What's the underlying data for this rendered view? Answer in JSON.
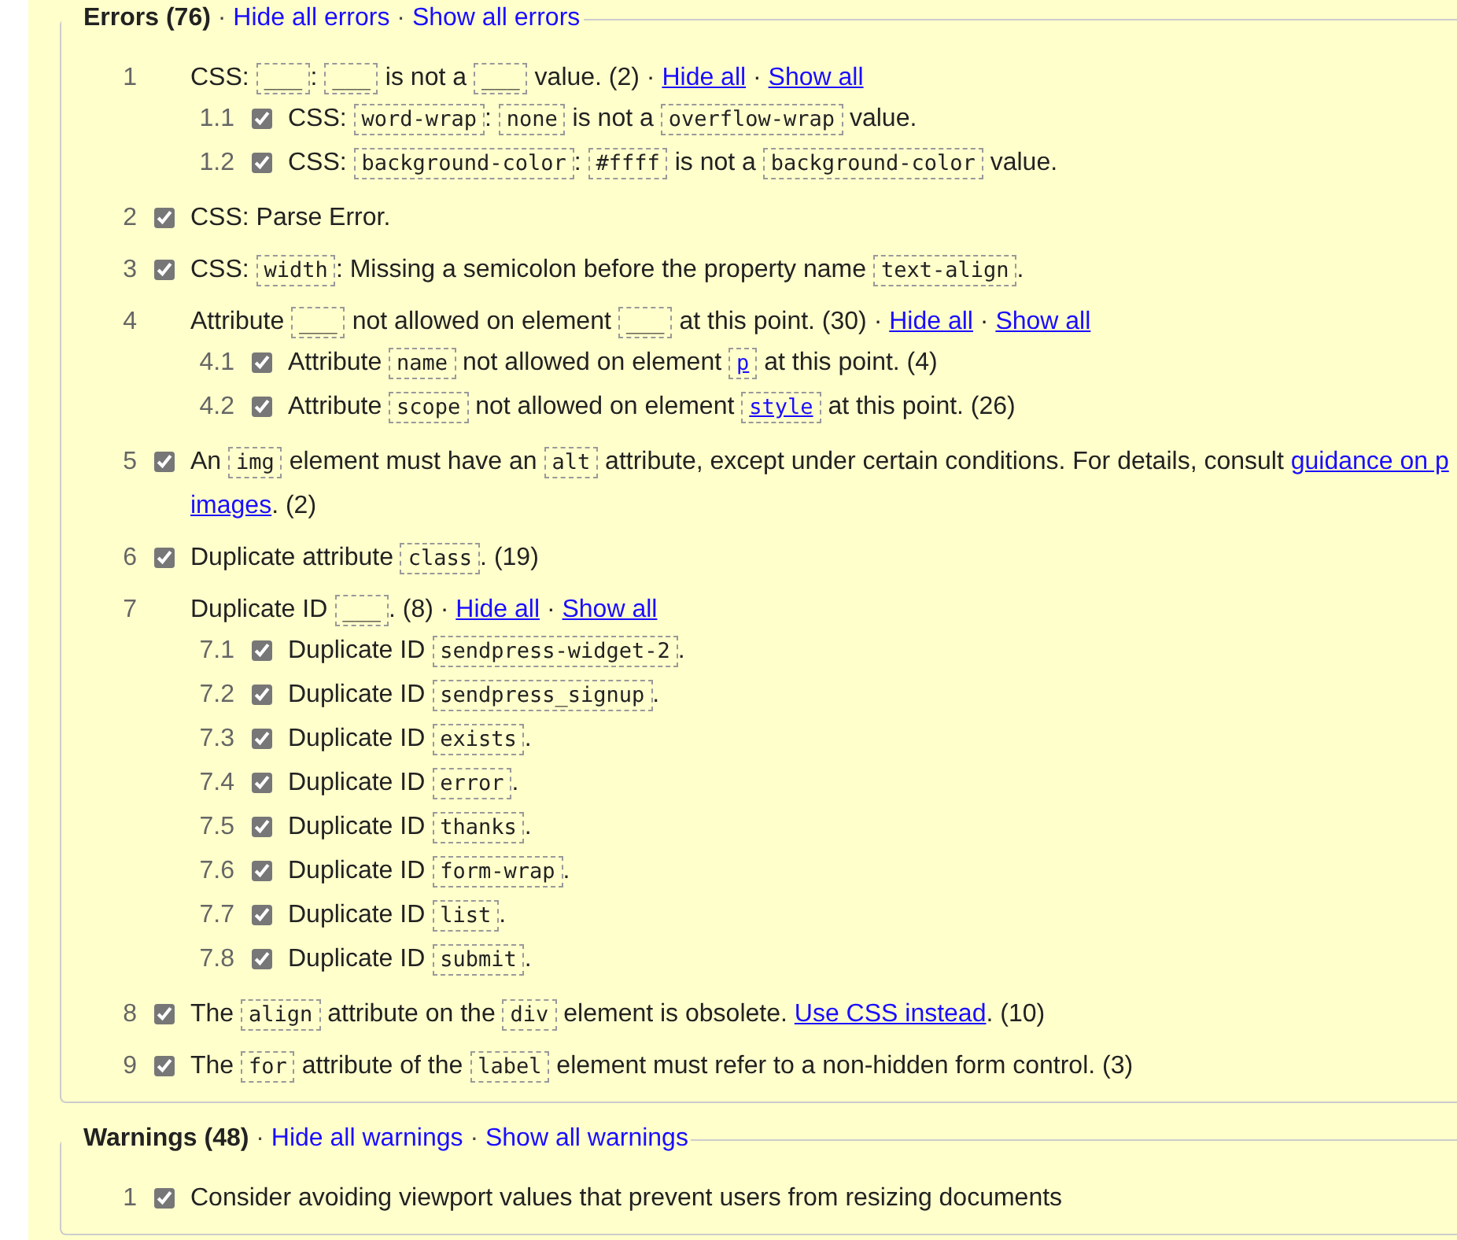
{
  "errors": {
    "title": "Errors (76)",
    "separator": " · ",
    "links": [
      "Hide all errors",
      "Show all errors"
    ],
    "items": [
      {
        "number": "1",
        "parts": [
          {
            "kind": "text",
            "text": "CSS: "
          },
          {
            "kind": "code",
            "text": "___"
          },
          {
            "kind": "text",
            "text": ": "
          },
          {
            "kind": "code",
            "text": "___"
          },
          {
            "kind": "text",
            "text": " is not a "
          },
          {
            "kind": "code",
            "text": "___"
          },
          {
            "kind": "text",
            "text": " value. (2) · "
          },
          {
            "kind": "link",
            "text": "Hide all"
          },
          {
            "kind": "text",
            "text": " · "
          },
          {
            "kind": "link",
            "text": "Show all"
          }
        ],
        "children": [
          {
            "number": "1.1",
            "checked": true,
            "parts": [
              {
                "kind": "text",
                "text": "CSS: "
              },
              {
                "kind": "code",
                "text": "word-wrap"
              },
              {
                "kind": "text",
                "text": ": "
              },
              {
                "kind": "code",
                "text": "none"
              },
              {
                "kind": "text",
                "text": " is not a "
              },
              {
                "kind": "code",
                "text": "overflow-wrap"
              },
              {
                "kind": "text",
                "text": " value."
              }
            ]
          },
          {
            "number": "1.2",
            "checked": true,
            "parts": [
              {
                "kind": "text",
                "text": "CSS: "
              },
              {
                "kind": "code",
                "text": "background-color"
              },
              {
                "kind": "text",
                "text": ": "
              },
              {
                "kind": "code",
                "text": "#ffff"
              },
              {
                "kind": "text",
                "text": " is not a "
              },
              {
                "kind": "code",
                "text": "background-color"
              },
              {
                "kind": "text",
                "text": " value."
              }
            ]
          }
        ]
      },
      {
        "number": "2",
        "checked": true,
        "parts": [
          {
            "kind": "text",
            "text": "CSS: Parse Error."
          }
        ]
      },
      {
        "number": "3",
        "checked": true,
        "parts": [
          {
            "kind": "text",
            "text": "CSS: "
          },
          {
            "kind": "code",
            "text": "width"
          },
          {
            "kind": "text",
            "text": ": Missing a semicolon before the property name "
          },
          {
            "kind": "code",
            "text": "text-align"
          },
          {
            "kind": "text",
            "text": "."
          }
        ]
      },
      {
        "number": "4",
        "parts": [
          {
            "kind": "text",
            "text": "Attribute "
          },
          {
            "kind": "code",
            "text": "___"
          },
          {
            "kind": "text",
            "text": " not allowed on element "
          },
          {
            "kind": "code",
            "text": "___"
          },
          {
            "kind": "text",
            "text": " at this point. (30) · "
          },
          {
            "kind": "link",
            "text": "Hide all"
          },
          {
            "kind": "text",
            "text": " · "
          },
          {
            "kind": "link",
            "text": "Show all"
          }
        ],
        "children": [
          {
            "number": "4.1",
            "checked": true,
            "parts": [
              {
                "kind": "text",
                "text": "Attribute "
              },
              {
                "kind": "code",
                "text": "name"
              },
              {
                "kind": "text",
                "text": " not allowed on element "
              },
              {
                "kind": "code_link",
                "text": "p"
              },
              {
                "kind": "text",
                "text": " at this point. (4)"
              }
            ]
          },
          {
            "number": "4.2",
            "checked": true,
            "parts": [
              {
                "kind": "text",
                "text": "Attribute "
              },
              {
                "kind": "code",
                "text": "scope"
              },
              {
                "kind": "text",
                "text": " not allowed on element "
              },
              {
                "kind": "code_link",
                "text": "style"
              },
              {
                "kind": "text",
                "text": " at this point. (26)"
              }
            ]
          }
        ]
      },
      {
        "number": "5",
        "checked": true,
        "parts": [
          {
            "kind": "text",
            "text": "An "
          },
          {
            "kind": "code",
            "text": "img"
          },
          {
            "kind": "text",
            "text": " element must have an "
          },
          {
            "kind": "code",
            "text": "alt"
          },
          {
            "kind": "text",
            "text": " attribute, except under certain conditions. For details, consult "
          },
          {
            "kind": "link",
            "text": "guidance on p"
          },
          {
            "kind": "break"
          },
          {
            "kind": "link",
            "text": "images"
          },
          {
            "kind": "text",
            "text": ". (2)"
          }
        ]
      },
      {
        "number": "6",
        "checked": true,
        "parts": [
          {
            "kind": "text",
            "text": "Duplicate attribute "
          },
          {
            "kind": "code",
            "text": "class"
          },
          {
            "kind": "text",
            "text": ". (19)"
          }
        ]
      },
      {
        "number": "7",
        "parts": [
          {
            "kind": "text",
            "text": "Duplicate ID "
          },
          {
            "kind": "code",
            "text": "___"
          },
          {
            "kind": "text",
            "text": ". (8) · "
          },
          {
            "kind": "link",
            "text": "Hide all"
          },
          {
            "kind": "text",
            "text": " · "
          },
          {
            "kind": "link",
            "text": "Show all"
          }
        ],
        "children": [
          {
            "number": "7.1",
            "checked": true,
            "parts": [
              {
                "kind": "text",
                "text": "Duplicate ID "
              },
              {
                "kind": "code",
                "text": "sendpress-widget-2"
              },
              {
                "kind": "text",
                "text": "."
              }
            ]
          },
          {
            "number": "7.2",
            "checked": true,
            "parts": [
              {
                "kind": "text",
                "text": "Duplicate ID "
              },
              {
                "kind": "code",
                "text": "sendpress_signup"
              },
              {
                "kind": "text",
                "text": "."
              }
            ]
          },
          {
            "number": "7.3",
            "checked": true,
            "parts": [
              {
                "kind": "text",
                "text": "Duplicate ID "
              },
              {
                "kind": "code",
                "text": "exists"
              },
              {
                "kind": "text",
                "text": "."
              }
            ]
          },
          {
            "number": "7.4",
            "checked": true,
            "parts": [
              {
                "kind": "text",
                "text": "Duplicate ID "
              },
              {
                "kind": "code",
                "text": "error"
              },
              {
                "kind": "text",
                "text": "."
              }
            ]
          },
          {
            "number": "7.5",
            "checked": true,
            "parts": [
              {
                "kind": "text",
                "text": "Duplicate ID "
              },
              {
                "kind": "code",
                "text": "thanks"
              },
              {
                "kind": "text",
                "text": "."
              }
            ]
          },
          {
            "number": "7.6",
            "checked": true,
            "parts": [
              {
                "kind": "text",
                "text": "Duplicate ID "
              },
              {
                "kind": "code",
                "text": "form-wrap"
              },
              {
                "kind": "text",
                "text": "."
              }
            ]
          },
          {
            "number": "7.7",
            "checked": true,
            "parts": [
              {
                "kind": "text",
                "text": "Duplicate ID "
              },
              {
                "kind": "code",
                "text": "list"
              },
              {
                "kind": "text",
                "text": "."
              }
            ]
          },
          {
            "number": "7.8",
            "checked": true,
            "parts": [
              {
                "kind": "text",
                "text": "Duplicate ID "
              },
              {
                "kind": "code",
                "text": "submit"
              },
              {
                "kind": "text",
                "text": "."
              }
            ]
          }
        ]
      },
      {
        "number": "8",
        "checked": true,
        "parts": [
          {
            "kind": "text",
            "text": "The "
          },
          {
            "kind": "code",
            "text": "align"
          },
          {
            "kind": "text",
            "text": " attribute on the "
          },
          {
            "kind": "code",
            "text": "div"
          },
          {
            "kind": "text",
            "text": " element is obsolete. "
          },
          {
            "kind": "link",
            "text": "Use CSS instead"
          },
          {
            "kind": "text",
            "text": ". (10)"
          }
        ]
      },
      {
        "number": "9",
        "checked": true,
        "parts": [
          {
            "kind": "text",
            "text": "The "
          },
          {
            "kind": "code",
            "text": "for"
          },
          {
            "kind": "text",
            "text": " attribute of the "
          },
          {
            "kind": "code",
            "text": "label"
          },
          {
            "kind": "text",
            "text": " element must refer to a non-hidden form control. (3)"
          }
        ]
      }
    ]
  },
  "warnings": {
    "title": "Warnings (48)",
    "separator": " · ",
    "links": [
      "Hide all warnings",
      "Show all warnings"
    ],
    "items": [
      {
        "number": "1",
        "checked": true,
        "parts": [
          {
            "kind": "text",
            "text": "Consider avoiding viewport values that prevent users from resizing documents"
          }
        ]
      }
    ]
  }
}
